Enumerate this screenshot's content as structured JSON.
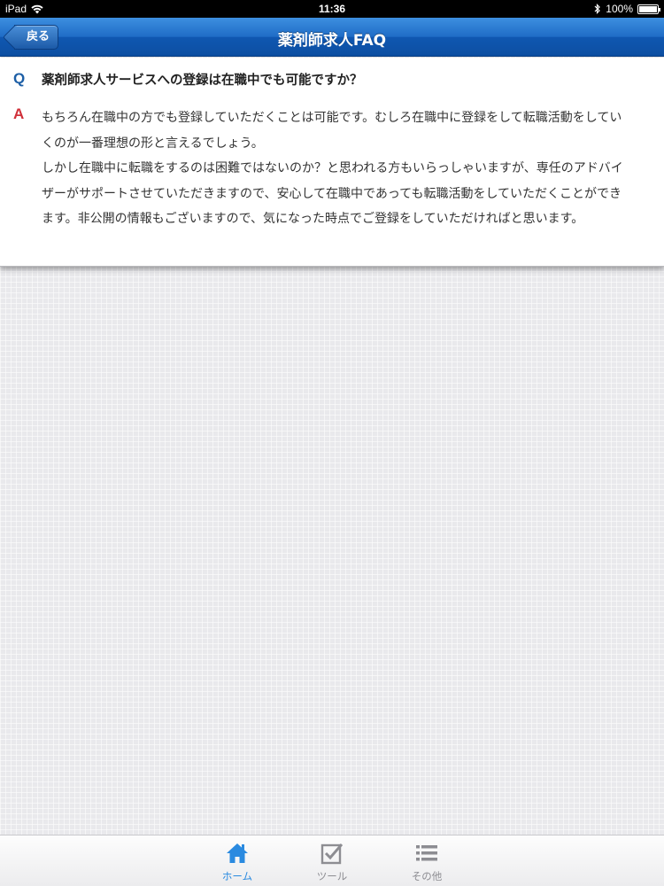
{
  "status_bar": {
    "device": "iPad",
    "time": "11:36",
    "battery": "100%",
    "battery_level": 1.0
  },
  "nav": {
    "back_label": "戻る",
    "title": "薬剤師求人FAQ"
  },
  "faq": {
    "q_mark": "Q",
    "question": "薬剤師求人サービスへの登録は在職中でも可能ですか？",
    "a_mark": "A",
    "answer": "もちろん在職中の方でも登録していただくことは可能です。むしろ在職中に登録をして転職活動をしていくのが一番理想の形と言えるでしょう。\nしかし在職中に転職をするのは困難ではないのか？と思われる方もいらっしゃいますが、専任のアドバイザーがサポートさせていただきますので、安心して在職中であっても転職活動をしていただくことができます。非公開の情報もございますので、気になった時点でご登録をしていただければと思います。"
  },
  "tabs": [
    {
      "label": "ホーム",
      "icon": "home-icon",
      "active": true
    },
    {
      "label": "ツール",
      "icon": "checkbox-icon",
      "active": false
    },
    {
      "label": "その他",
      "icon": "list-icon",
      "active": false
    }
  ],
  "colors": {
    "nav_blue": "#1f6cc6",
    "q_color": "#1d5fa6",
    "a_color": "#d0303a",
    "tab_active": "#2a8ae0",
    "tab_inactive": "#8d8d92"
  }
}
